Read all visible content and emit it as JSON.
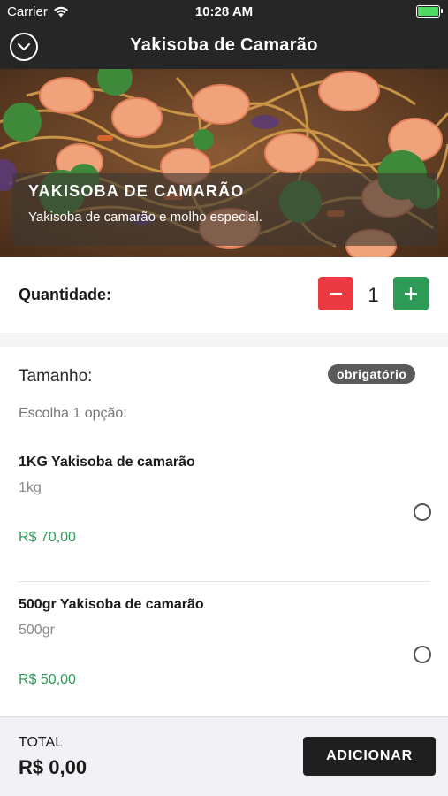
{
  "status_bar": {
    "carrier": "Carrier",
    "time": "10:28 AM",
    "battery_color": "#4cd964"
  },
  "navbar": {
    "title": "Yakisoba de Camarão",
    "back_icon": "chevron-down-circle-icon"
  },
  "product": {
    "name": "YAKISOBA DE CAMARÃO",
    "description": "Yakisoba de camarão e molho especial."
  },
  "quantity": {
    "label": "Quantidade:",
    "value": "1",
    "minus_icon": "minus-icon",
    "plus_icon": "plus-icon",
    "minus_color": "#eb3a41",
    "plus_color": "#2e9a58"
  },
  "size": {
    "title": "Tamanho:",
    "badge": "obrigatório",
    "hint": "Escolha 1 opção:",
    "options": [
      {
        "name": "1KG Yakisoba de camarão",
        "sub": "1kg",
        "price": "R$ 70,00",
        "selected": false
      },
      {
        "name": "500gr Yakisoba de camarão",
        "sub": "500gr",
        "price": "R$ 50,00",
        "selected": false
      }
    ]
  },
  "footer": {
    "total_label": "TOTAL",
    "total_value": "R$ 0,00",
    "add_label": "ADICIONAR"
  },
  "colors": {
    "header_bg": "#262626",
    "price_green": "#2e9a58",
    "footer_bg": "#f2f2f6"
  }
}
